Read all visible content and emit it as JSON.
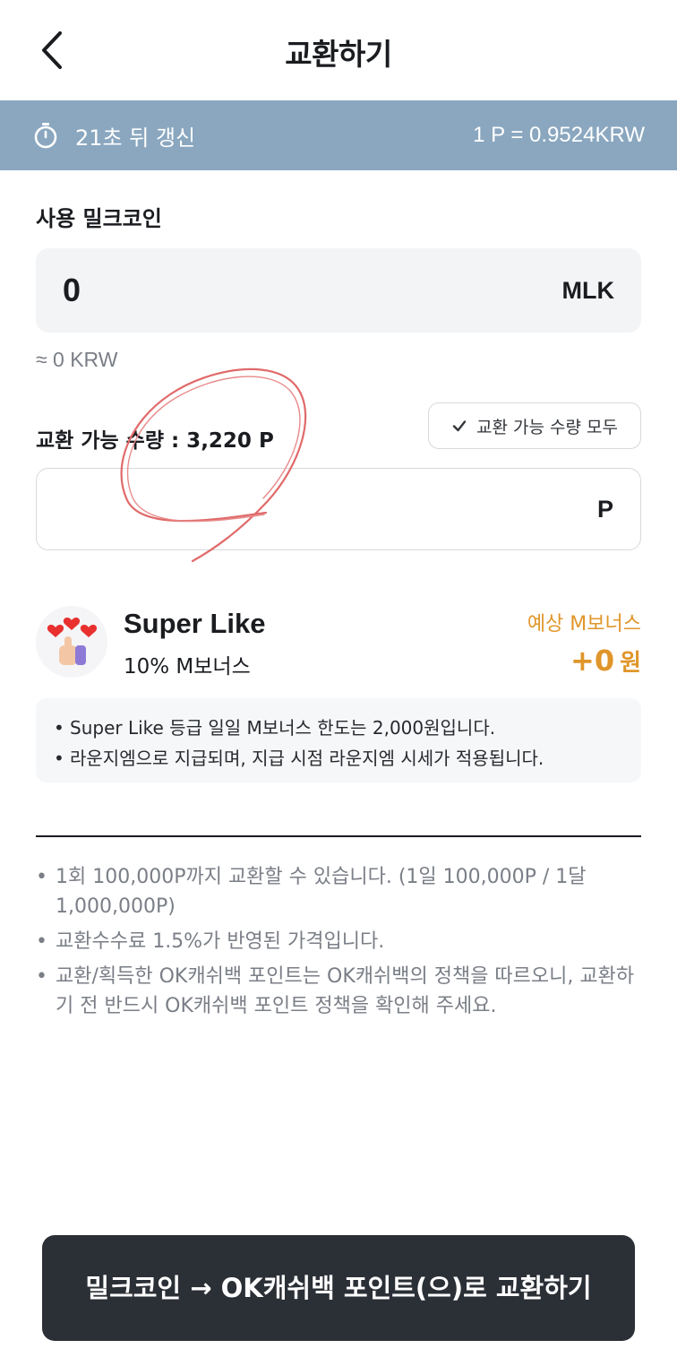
{
  "header": {
    "title": "교환하기",
    "back_icon": "chevron-left-icon"
  },
  "rate_bar": {
    "refresh_text": "21초 뒤 갱신",
    "rate_text": "1 P = 0.9524KRW",
    "icon": "timer-icon",
    "bg_color": "#8aa7bf"
  },
  "mlk": {
    "label": "사용 밀크코인",
    "amount": "0",
    "unit": "MLK",
    "krw_approx": "≈ 0 KRW"
  },
  "points": {
    "available_label": "교환 가능 수량 : 3,220 P",
    "select_all_label": "교환 가능 수량 모두",
    "unit": "P",
    "value": ""
  },
  "grade": {
    "name": "Super Like",
    "desc": "10% M보너스",
    "bonus_label": "예상 M보너스",
    "bonus_value": "+0",
    "bonus_unit": "원",
    "icon": "hearts-thumbs-up-icon",
    "accent": "#e0962a"
  },
  "info": [
    "Super Like 등급 일일 M보너스 한도는 2,000원입니다.",
    "라운지엠으로 지급되며, 지급 시점 라운지엠 시세가 적용됩니다."
  ],
  "notes": [
    "1회 100,000P까지 교환할 수 있습니다. (1일 100,000P / 1달 1,000,000P)",
    "교환수수료 1.5%가 반영된 가격입니다.",
    "교환/획득한 OK캐쉬백 포인트는 OK캐쉬백의 정책을 따르오니, 교환하기 전 반드시 OK캐쉬백 포인트 정책을 확인해 주세요."
  ],
  "action": {
    "label": "밀크코인 → OK캐쉬백 포인트(으)로 교환하기"
  }
}
